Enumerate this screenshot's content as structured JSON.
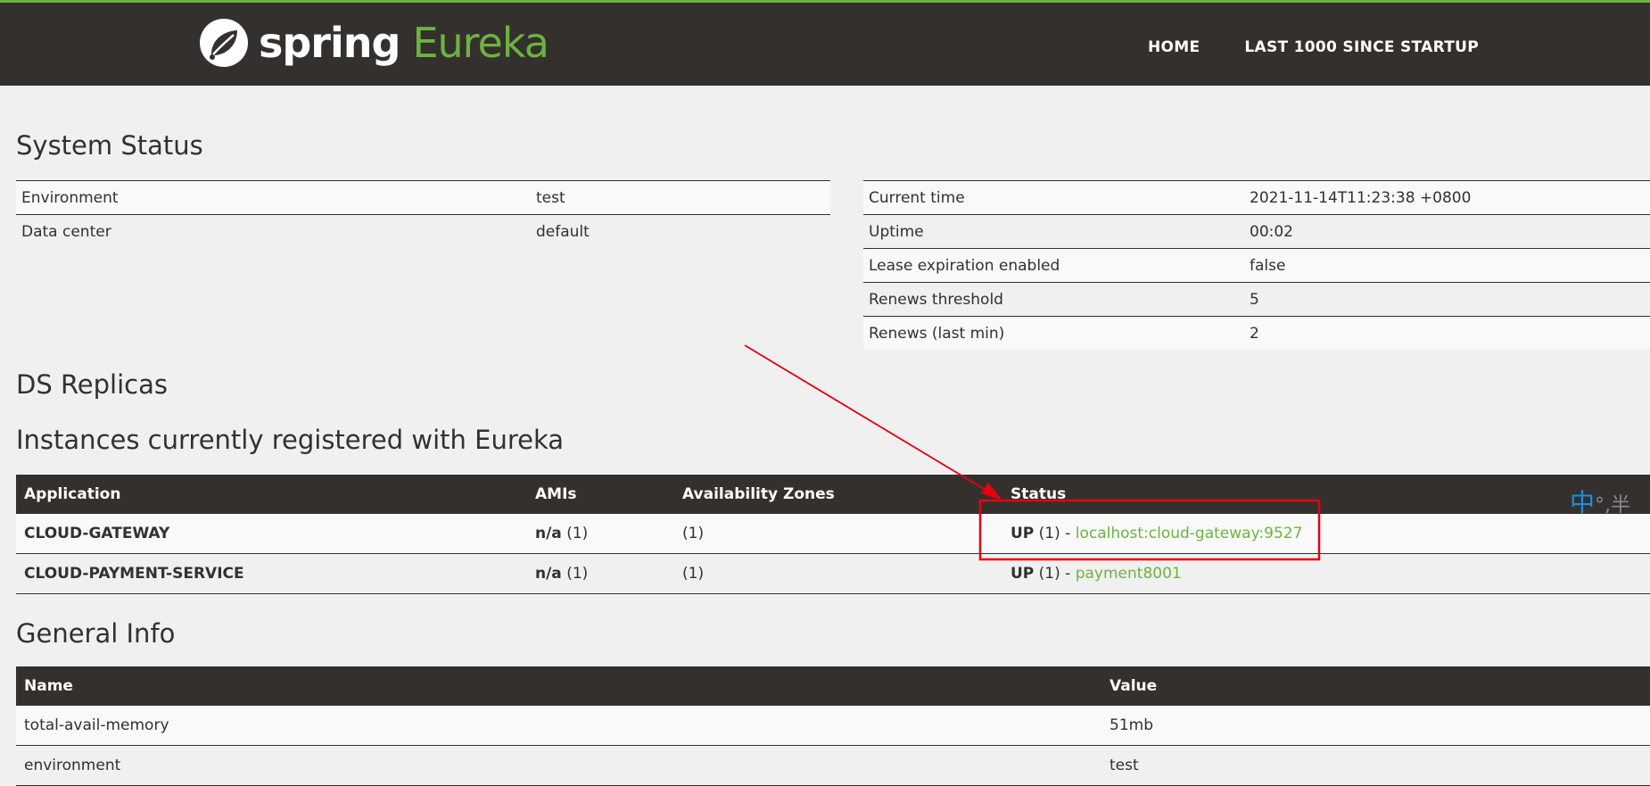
{
  "header": {
    "brand_spring": "spring",
    "brand_eureka": "Eureka",
    "nav": [
      "HOME",
      "LAST 1000 SINCE STARTUP"
    ]
  },
  "system_status": {
    "title": "System Status",
    "left": [
      {
        "label": "Environment",
        "value": "test"
      },
      {
        "label": "Data center",
        "value": "default"
      }
    ],
    "right": [
      {
        "label": "Current time",
        "value": "2021-11-14T11:23:38 +0800"
      },
      {
        "label": "Uptime",
        "value": "00:02"
      },
      {
        "label": "Lease expiration enabled",
        "value": "false"
      },
      {
        "label": "Renews threshold",
        "value": "5"
      },
      {
        "label": "Renews (last min)",
        "value": "2"
      }
    ]
  },
  "ds_replicas": {
    "title": "DS Replicas"
  },
  "instances": {
    "title": "Instances currently registered with Eureka",
    "headers": [
      "Application",
      "AMIs",
      "Availability Zones",
      "Status"
    ],
    "rows": [
      {
        "application": "CLOUD-GATEWAY",
        "ami": "n/a",
        "ami_count": "(1)",
        "zones": "(1)",
        "status": "UP",
        "status_count": "(1)",
        "separator": "-",
        "instance": "localhost:cloud-gateway:9527"
      },
      {
        "application": "CLOUD-PAYMENT-SERVICE",
        "ami": "n/a",
        "ami_count": "(1)",
        "zones": "(1)",
        "status": "UP",
        "status_count": "(1)",
        "separator": "-",
        "instance": "payment8001"
      }
    ]
  },
  "general_info": {
    "title": "General Info",
    "headers": [
      "Name",
      "Value"
    ],
    "rows": [
      {
        "name": "total-avail-memory",
        "value": "51mb"
      },
      {
        "name": "environment",
        "value": "test"
      }
    ]
  },
  "ime": {
    "mode": "中",
    "punct": "°,",
    "width": "半"
  },
  "colors": {
    "accent": "#6db33f",
    "dark": "#34302d",
    "annotation": "#e60012"
  }
}
